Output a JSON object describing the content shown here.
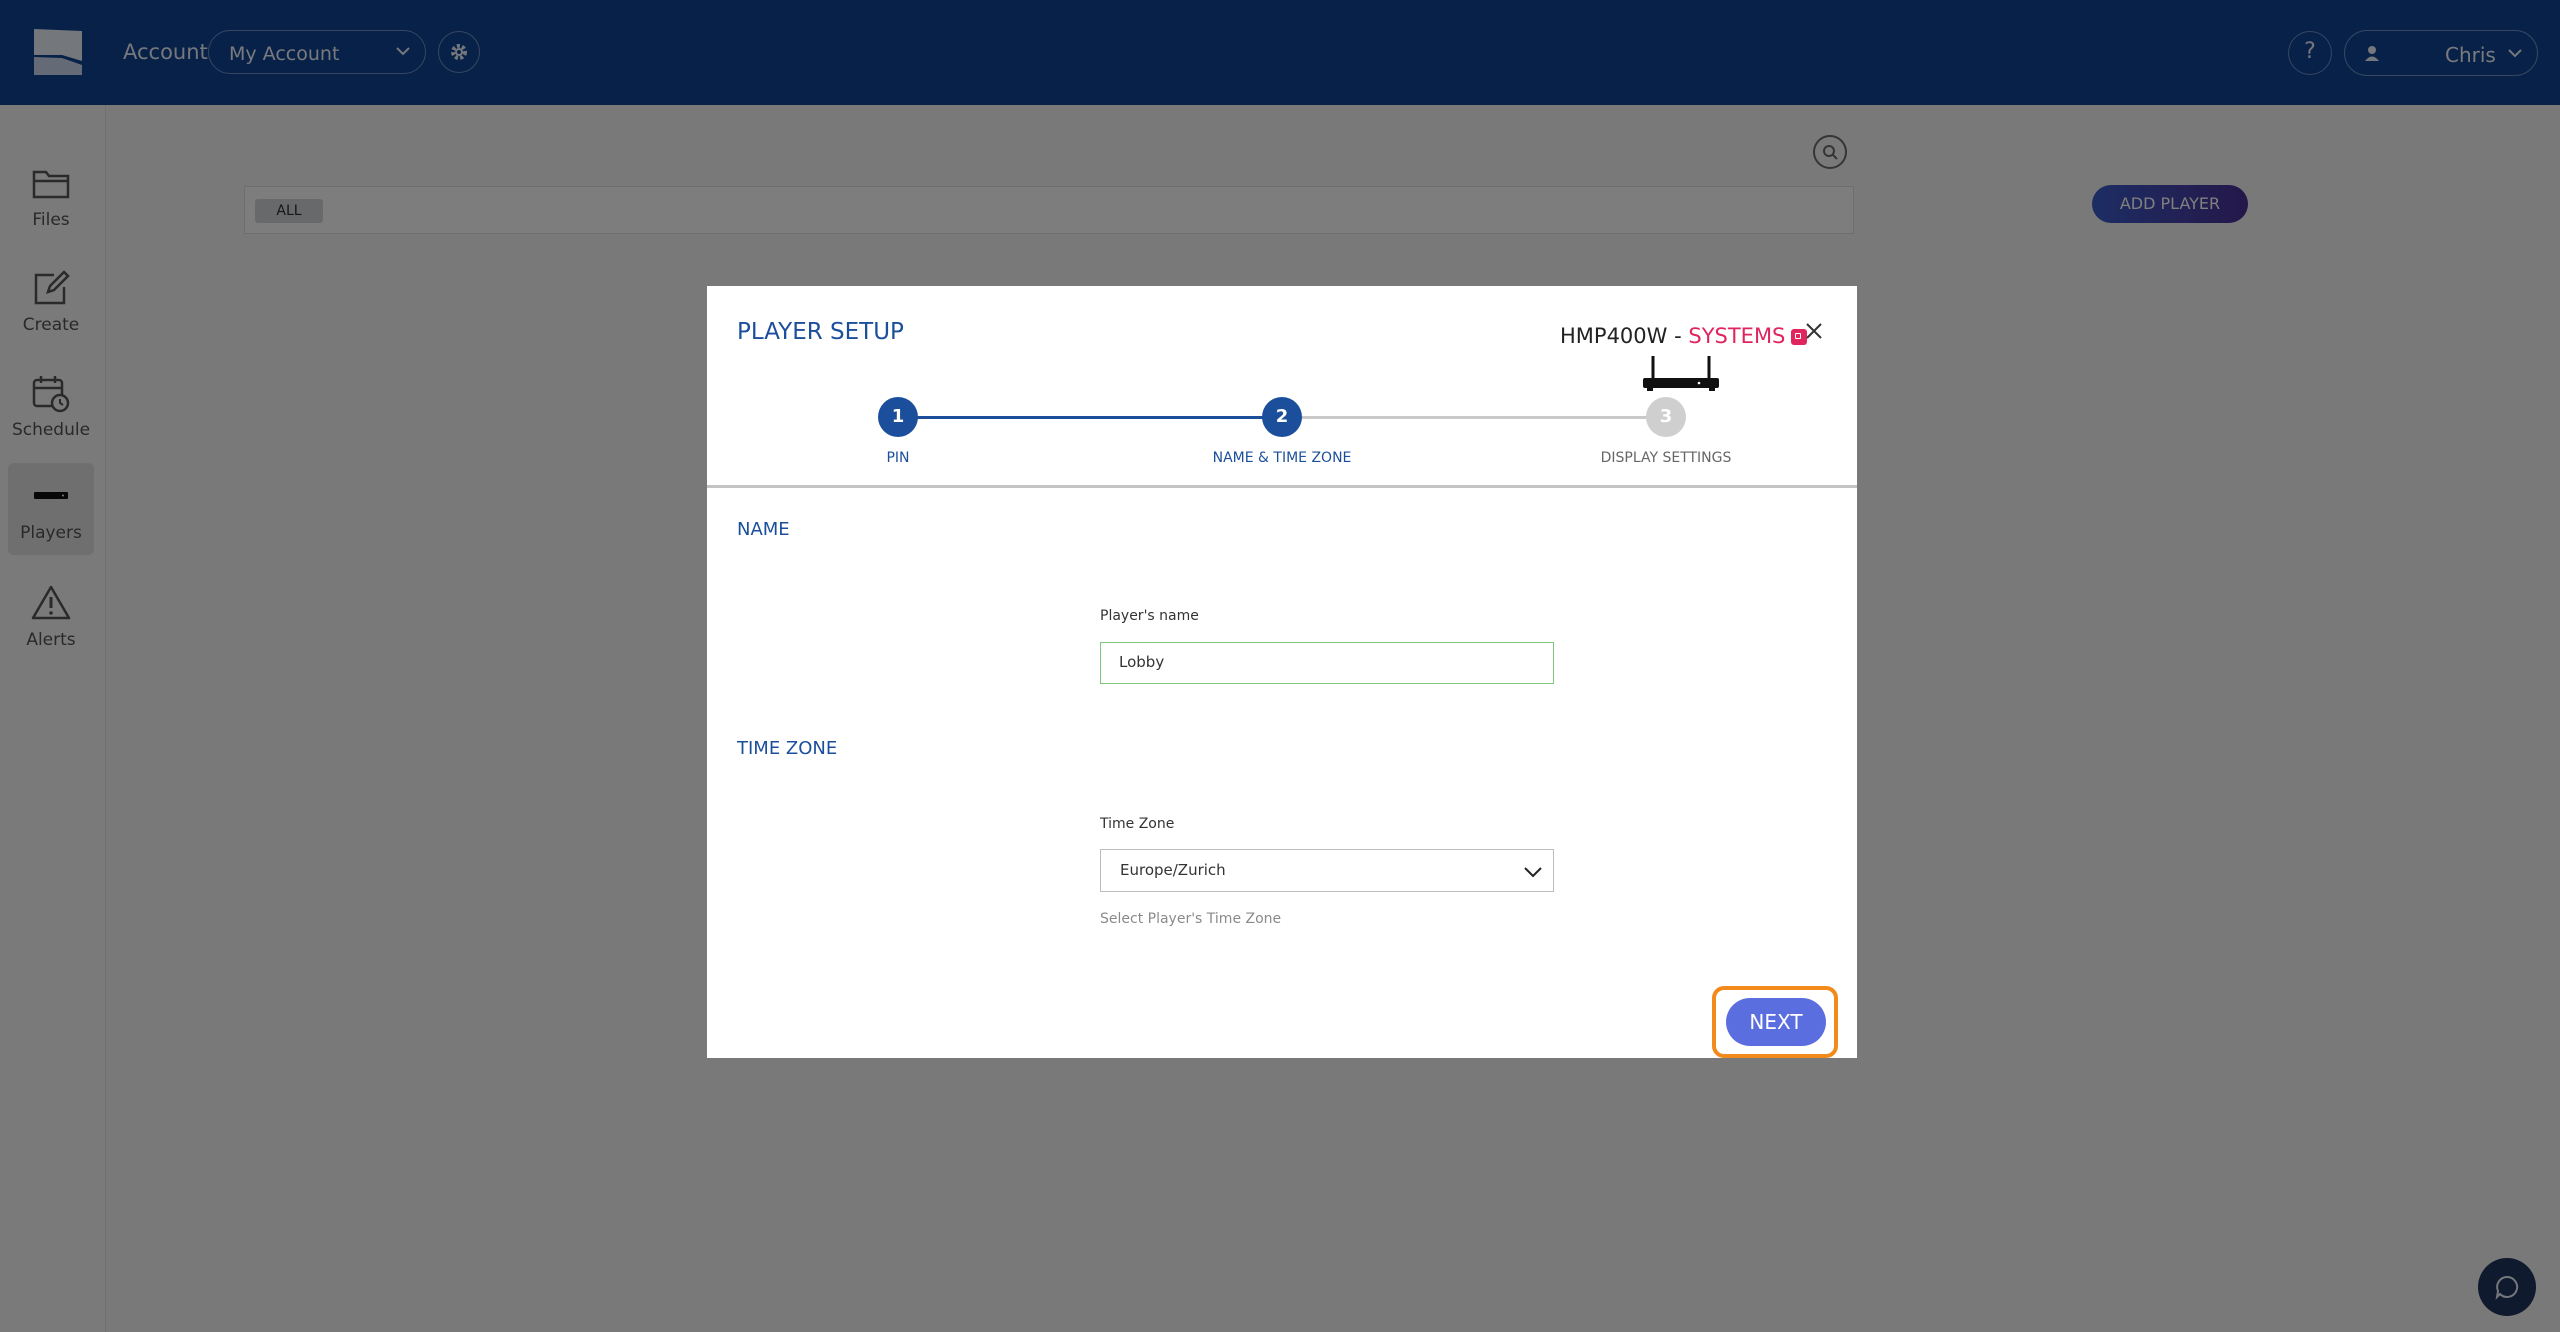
{
  "header": {
    "account_label": "Account",
    "account_select_value": "My Account",
    "help_label": "?",
    "user_name": "Chris"
  },
  "sidebar": {
    "items": [
      {
        "label": "Files",
        "icon": "folder-icon",
        "active": false
      },
      {
        "label": "Create",
        "icon": "edit-icon",
        "active": false
      },
      {
        "label": "Schedule",
        "icon": "calendar-clock-icon",
        "active": false
      },
      {
        "label": "Players",
        "icon": "player-device-icon",
        "active": true
      },
      {
        "label": "Alerts",
        "icon": "warning-icon",
        "active": false
      }
    ]
  },
  "content": {
    "filter_chip": "ALL",
    "add_player_label": "ADD PLAYER"
  },
  "modal": {
    "title": "PLAYER SETUP",
    "model": "HMP400W",
    "model_separator": " - ",
    "brand": "SYSTEMS",
    "steps": [
      {
        "number": "1",
        "label": "PIN",
        "state": "done"
      },
      {
        "number": "2",
        "label": "NAME & TIME ZONE",
        "state": "current"
      },
      {
        "number": "3",
        "label": "DISPLAY SETTINGS",
        "state": "pending"
      }
    ],
    "name_section": "NAME",
    "name_field_label": "Player's name",
    "name_value": "Lobby",
    "timezone_section": "TIME ZONE",
    "timezone_field_label": "Time Zone",
    "timezone_value": "Europe/Zurich",
    "timezone_help": "Select Player's Time Zone",
    "next_label": "NEXT"
  },
  "colors": {
    "topbar": "#0f4291",
    "accent_blue": "#1c4f9b",
    "brand_red": "#e0245e",
    "next_button": "#5b6ee0",
    "highlight": "#f28b1c"
  }
}
